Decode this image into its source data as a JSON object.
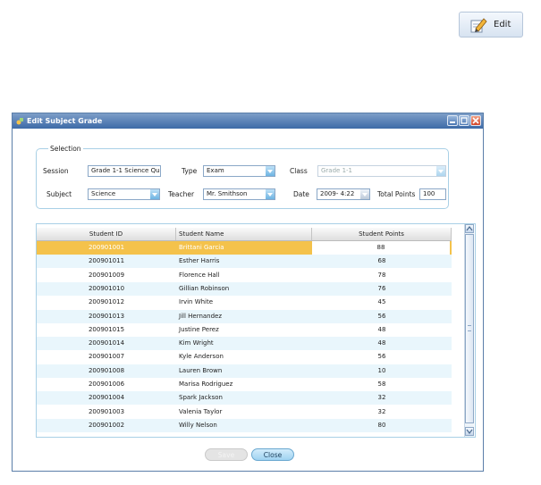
{
  "toolbar": {
    "edit_label": "Edit"
  },
  "dialog": {
    "title": "Edit Subject Grade",
    "selection_legend": "Selection",
    "session": {
      "label": "Session",
      "value": "Grade 1-1 Science Qu"
    },
    "type": {
      "label": "Type",
      "value": "Exam"
    },
    "class": {
      "label": "Class",
      "value": "Grade 1-1"
    },
    "subject": {
      "label": "Subject",
      "value": "Science"
    },
    "teacher": {
      "label": "Teacher",
      "value": "Mr. Smithson"
    },
    "date": {
      "label": "Date",
      "value": "2009-  4:22"
    },
    "total_points": {
      "label": "Total Points",
      "value": "100"
    },
    "columns": [
      "Student ID",
      "Student Name",
      "Student Points"
    ],
    "rows": [
      {
        "id": "200901001",
        "name": "Brittani Garcia",
        "points": "88"
      },
      {
        "id": "200901011",
        "name": "Esther Harris",
        "points": "68"
      },
      {
        "id": "200901009",
        "name": "Florence Hall",
        "points": "78"
      },
      {
        "id": "200901010",
        "name": "Gillian Robinson",
        "points": "76"
      },
      {
        "id": "200901012",
        "name": "Irvin White",
        "points": "45"
      },
      {
        "id": "200901013",
        "name": "Jill Hernandez",
        "points": "56"
      },
      {
        "id": "200901015",
        "name": "Justine Perez",
        "points": "48"
      },
      {
        "id": "200901014",
        "name": "Kim Wright",
        "points": "48"
      },
      {
        "id": "200901007",
        "name": "Kyle Anderson",
        "points": "56"
      },
      {
        "id": "200901008",
        "name": "Lauren Brown",
        "points": "10"
      },
      {
        "id": "200901006",
        "name": "Marisa Rodriguez",
        "points": "58"
      },
      {
        "id": "200901004",
        "name": "Spark Jackson",
        "points": "32"
      },
      {
        "id": "200901003",
        "name": "Valenia Taylor",
        "points": "32"
      },
      {
        "id": "200901002",
        "name": "Willy Nelson",
        "points": "80"
      }
    ],
    "buttons": {
      "save": "Save",
      "close": "Close"
    }
  }
}
